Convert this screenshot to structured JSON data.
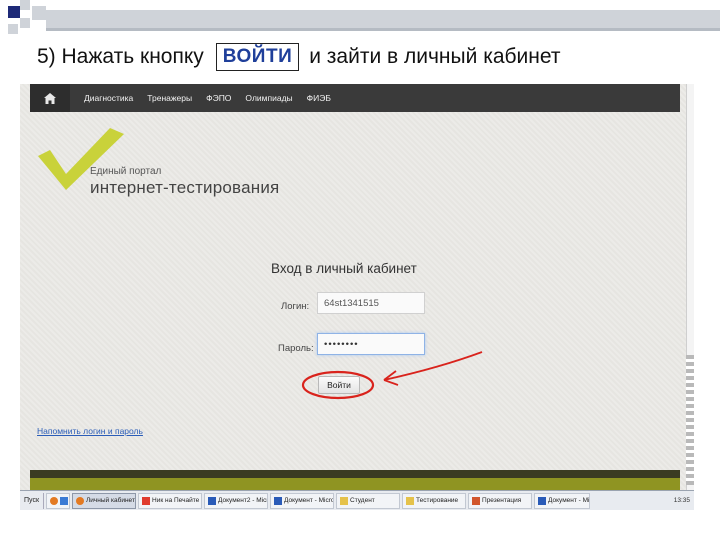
{
  "slide": {
    "title_prefix": "5) Нажать кнопку",
    "title_button": "ВОЙТИ",
    "title_suffix": "и зайти в личный кабинет"
  },
  "site": {
    "nav": [
      {
        "label": "Диагностика"
      },
      {
        "label": "Тренажеры"
      },
      {
        "label": "ФЭПО"
      },
      {
        "label": "Олимпиады"
      },
      {
        "label": "ФИЭБ"
      }
    ],
    "logo_small": "Единый портал",
    "logo_big": "интернет-тестирования",
    "form_title": "Вход в личный кабинет",
    "login_label": "Логин:",
    "login_value": "64st1341515",
    "password_label": "Пароль:",
    "password_value": "••••••••",
    "submit_label": "Войти",
    "forgot_link": "Напомнить логин и пароль",
    "accent_color": "#c9d23a",
    "footer_color": "#8f9422"
  },
  "taskbar": {
    "start_label": "Пуск",
    "items": [
      {
        "label": "Личный кабинет",
        "icon": "browser-icon",
        "active": true
      },
      {
        "label": "Ник на Печайте",
        "icon": "mail-icon"
      },
      {
        "label": "Документ2 - Micros",
        "icon": "word-icon"
      },
      {
        "label": "Документ - Micros",
        "icon": "word-icon"
      },
      {
        "label": "Студент",
        "icon": "folder-icon"
      },
      {
        "label": "Тестирование",
        "icon": "folder-icon"
      },
      {
        "label": "Презентация",
        "icon": "ppt-icon"
      },
      {
        "label": "Документ - Micros",
        "icon": "word-icon"
      }
    ],
    "clock": "13:35"
  }
}
